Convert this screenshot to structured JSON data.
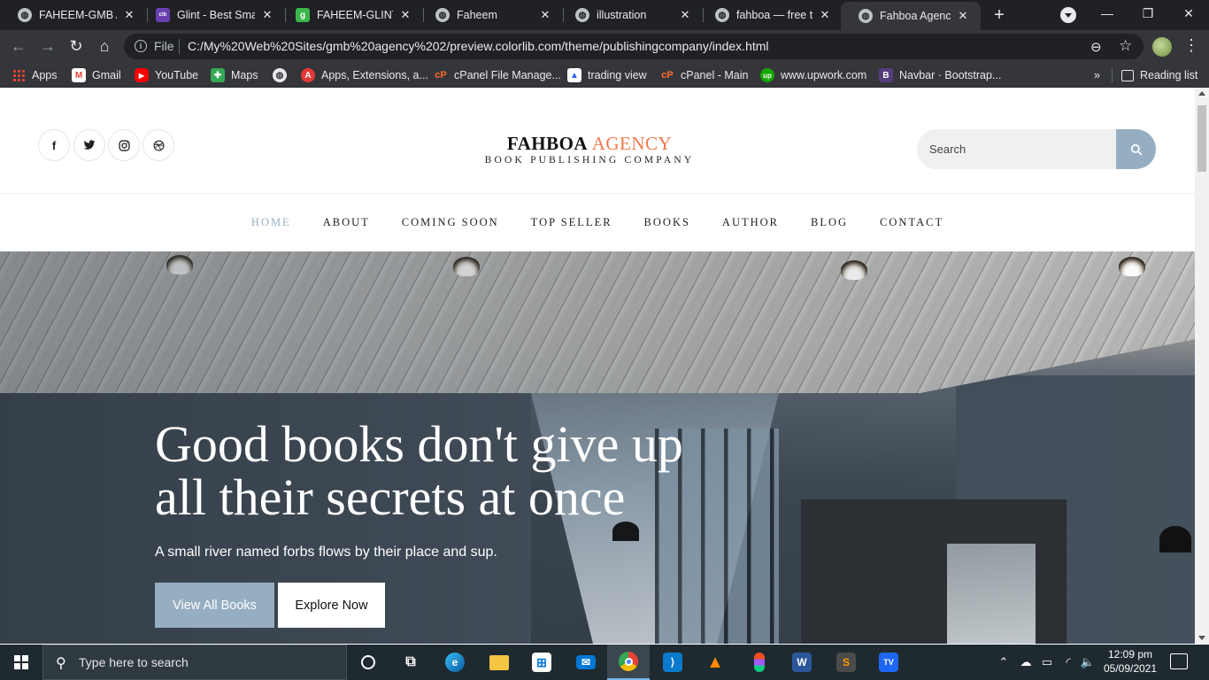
{
  "browser": {
    "tabs": [
      {
        "label": "FAHEEM-GMB AG",
        "icon": "globe-icon",
        "active": false
      },
      {
        "label": "Glint - Best Small",
        "icon": "colorlib-icon",
        "active": false
      },
      {
        "label": "FAHEEM-GLINT",
        "icon": "glint-g-icon",
        "active": false
      },
      {
        "label": "Faheem",
        "icon": "globe-icon",
        "active": false
      },
      {
        "label": "illustration",
        "icon": "globe-icon",
        "active": false
      },
      {
        "label": "fahboa — free ter",
        "icon": "globe-icon",
        "active": false
      },
      {
        "label": "Fahboa Agency",
        "icon": "globe-icon",
        "active": true
      }
    ],
    "new_tab": "+",
    "address": {
      "scheme_label": "File",
      "url": "C:/My%20Web%20Sites/gmb%20agency%202/preview.colorlib.com/theme/publishingcompany/index.html"
    },
    "bookmarks": [
      {
        "label": "Apps",
        "icon": "apps-grid-icon",
        "color": "#ea4335"
      },
      {
        "label": "Gmail",
        "icon": "gmail-icon",
        "color": "#ea4335"
      },
      {
        "label": "YouTube",
        "icon": "youtube-icon",
        "color": "#ff0000"
      },
      {
        "label": "Maps",
        "icon": "maps-icon",
        "color": "#34a853"
      },
      {
        "label": "",
        "icon": "globe-icon",
        "color": "#e8eaed"
      },
      {
        "label": "Apps, Extensions, a...",
        "icon": "app-extensions-icon",
        "color": "#e53935"
      },
      {
        "label": "cPanel File Manage...",
        "icon": "cpanel-icon",
        "color": "#ff6c2c"
      },
      {
        "label": "trading view",
        "icon": "trading-view-icon",
        "color": "#2962ff"
      },
      {
        "label": "cPanel - Main",
        "icon": "cpanel-icon",
        "color": "#ff6c2c"
      },
      {
        "label": "www.upwork.com",
        "icon": "upwork-icon",
        "color": "#14a800"
      },
      {
        "label": "Navbar · Bootstrap...",
        "icon": "bootstrap-icon",
        "color": "#563d7c"
      }
    ],
    "overflow": "»",
    "reading_list": "Reading list"
  },
  "site": {
    "social": [
      "f",
      "t",
      "ig",
      "dr"
    ],
    "logo": {
      "title_main": "FAHBOA ",
      "title_accent": "AGENCY",
      "subtitle": "BOOK PUBLISHING COMPANY"
    },
    "search": {
      "placeholder": "Search"
    },
    "nav": [
      "HOME",
      "ABOUT",
      "COMING SOON",
      "TOP SELLER",
      "BOOKS",
      "AUTHOR",
      "BLOG",
      "CONTACT"
    ],
    "nav_active_index": 0,
    "hero": {
      "title_line1": "Good books don't give up",
      "title_line2": "all their secrets at once",
      "subtitle": "A small river named forbs flows by their place and sup.",
      "primary_button": "View All Books",
      "secondary_button": "Explore Now"
    },
    "colors": {
      "accent": "#f0794b",
      "primary": "#96aec2"
    }
  },
  "taskbar": {
    "search_placeholder": "Type here to search",
    "pinned": [
      "cortana-icon",
      "task-view-icon",
      "edge-icon",
      "file-explorer-icon",
      "store-icon",
      "mail-icon",
      "chrome-icon",
      "vscode-icon",
      "vlc-icon",
      "figma-icon",
      "word-icon",
      "sublime-icon",
      "typora-icon"
    ],
    "time": "12:09 pm",
    "date": "05/09/2021"
  }
}
